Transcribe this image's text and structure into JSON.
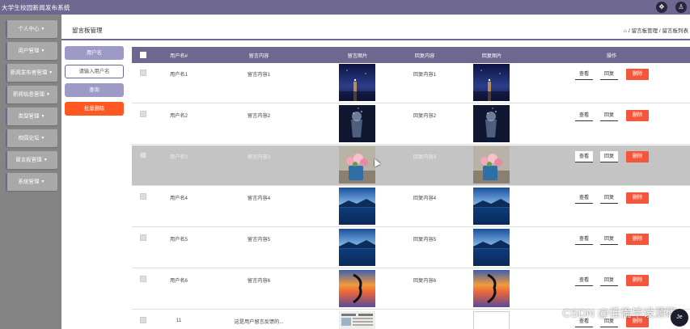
{
  "app": {
    "title": "大学生校园新闻发布系统"
  },
  "sidebar": {
    "items": [
      {
        "label": "个人中心"
      },
      {
        "label": "用户管理"
      },
      {
        "label": "新闻发布者管理"
      },
      {
        "label": "新闻信息管理"
      },
      {
        "label": "类型管理"
      },
      {
        "label": "校园论坛"
      },
      {
        "label": "留言板管理"
      },
      {
        "label": "系统管理"
      }
    ]
  },
  "header": {
    "page_title": "留言板管理",
    "breadcrumb": [
      "留言板管理",
      "留言板列表"
    ]
  },
  "search": {
    "field_label": "用户名",
    "placeholder": "请输入用户名",
    "search_label": "查询",
    "batch_delete_label": "批量删除"
  },
  "table": {
    "columns": [
      "用户名#",
      "留言内容",
      "留言图片",
      "回复内容",
      "回复图片",
      "操作"
    ],
    "rows": [
      {
        "username": "用户名1",
        "content": "留言内容1",
        "reply": "回复内容1",
        "image": "lake-night"
      },
      {
        "username": "用户名2",
        "content": "留言内容2",
        "reply": "回复内容2",
        "image": "glass-sparkle"
      },
      {
        "username": "用户名3",
        "content": "留言内容3",
        "reply": "回复内容3",
        "image": "flowers-bucket"
      },
      {
        "username": "用户名4",
        "content": "留言内容4",
        "reply": "回复内容4",
        "image": "blue-lake"
      },
      {
        "username": "用户名5",
        "content": "留言内容5",
        "reply": "回复内容5",
        "image": "blue-lake"
      },
      {
        "username": "用户名6",
        "content": "留言内容6",
        "reply": "回复内容6",
        "image": "sunset-reflection"
      },
      {
        "username": "11",
        "content": "这是用户留言反馈的...",
        "reply": "",
        "image": "newspaper"
      }
    ],
    "actions": {
      "view": "查看",
      "reply": "回复",
      "delete": "删除"
    }
  },
  "watermark": "CSDN @佳倫毕设源码",
  "colors": {
    "topbar": "#6e6890",
    "sidebar": "#848484",
    "sidebar_item": "#a9a9a9",
    "accent": "#9d9ac6",
    "danger": "#ff5722"
  }
}
